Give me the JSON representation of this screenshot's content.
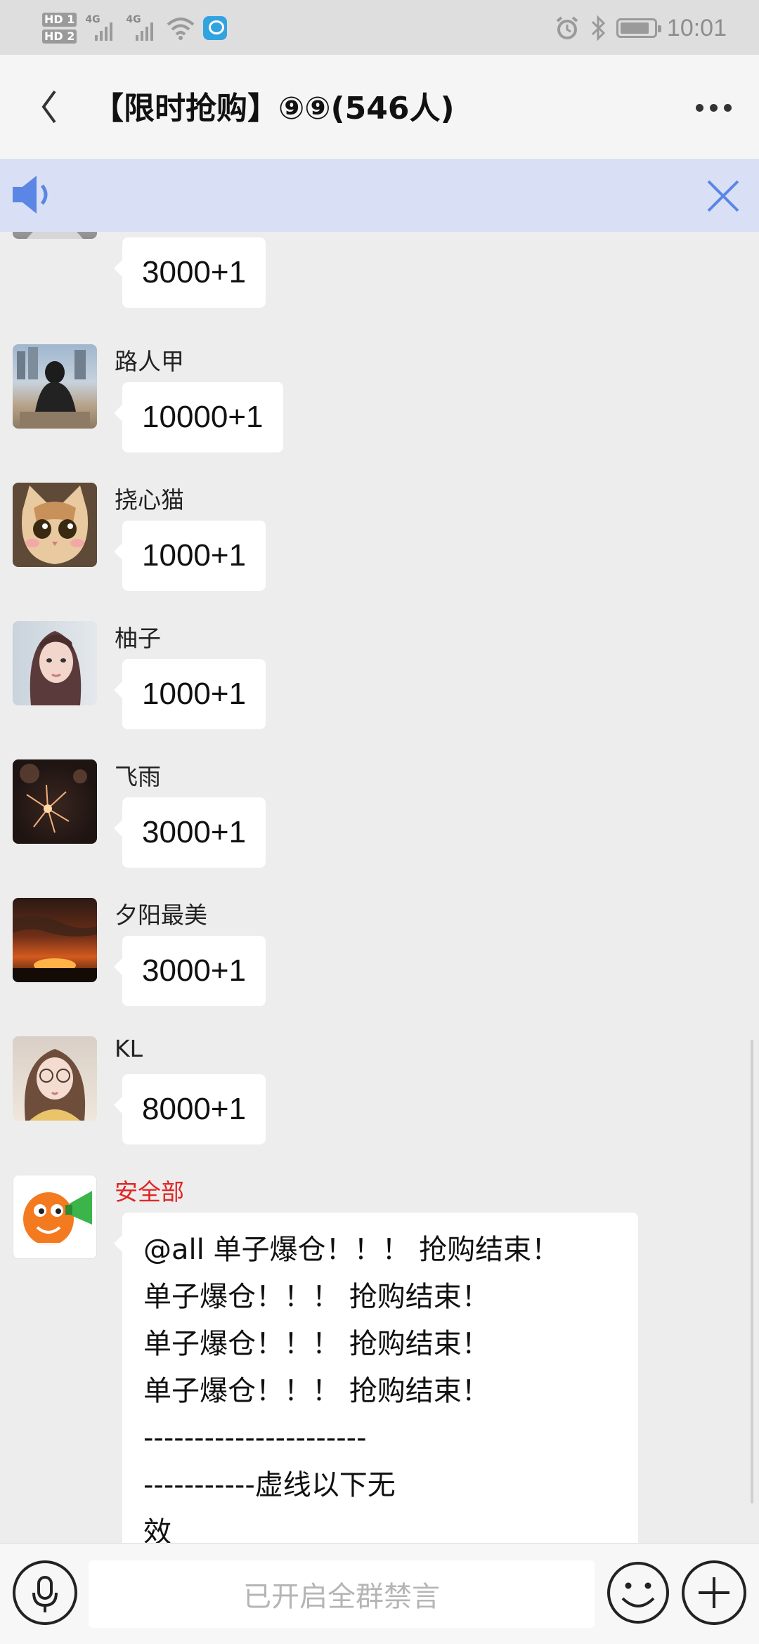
{
  "status_bar": {
    "hd1": "HD 1",
    "hd2": "HD 2",
    "net1": "4G",
    "net2": "4G",
    "time": "10:01",
    "icons": [
      "alarm-icon",
      "bluetooth-icon",
      "battery-icon",
      "wifi-icon"
    ]
  },
  "header": {
    "back_icon": "chevron-left-icon",
    "title": "【限时抢购】⑨⑨(546人)",
    "more_icon": "more-dots-icon"
  },
  "notice": {
    "icon": "speaker-icon",
    "close_icon": "close-icon"
  },
  "messages": [
    {
      "sender": "",
      "text": "3000+1"
    },
    {
      "sender": "路人甲",
      "text": "10000+1"
    },
    {
      "sender": "挠心猫",
      "text": "1000+1"
    },
    {
      "sender": "柚子",
      "text": "1000+1"
    },
    {
      "sender": "飞雨",
      "text": "3000+1"
    },
    {
      "sender": "夕阳最美",
      "text": "3000+1"
    },
    {
      "sender": "KL",
      "text": "8000+1"
    },
    {
      "sender": "安全部",
      "lines": [
        "@all 单子爆仓！！！ 抢购结束！",
        "单子爆仓！！！ 抢购结束！",
        "单子爆仓！！！ 抢购结束！",
        "单子爆仓！！！ 抢购结束！",
        "----------------------",
        "-----------虚线以下无",
        "效"
      ]
    }
  ],
  "input_bar": {
    "voice_icon": "microphone-icon",
    "placeholder": "已开启全群禁言",
    "emoji_icon": "smiley-icon",
    "plus_icon": "plus-icon"
  },
  "colors": {
    "notice_bg": "#d9e0f5",
    "accent_blue": "#5b86e5",
    "sender_red": "#e12424",
    "chat_bg": "#ededed"
  }
}
